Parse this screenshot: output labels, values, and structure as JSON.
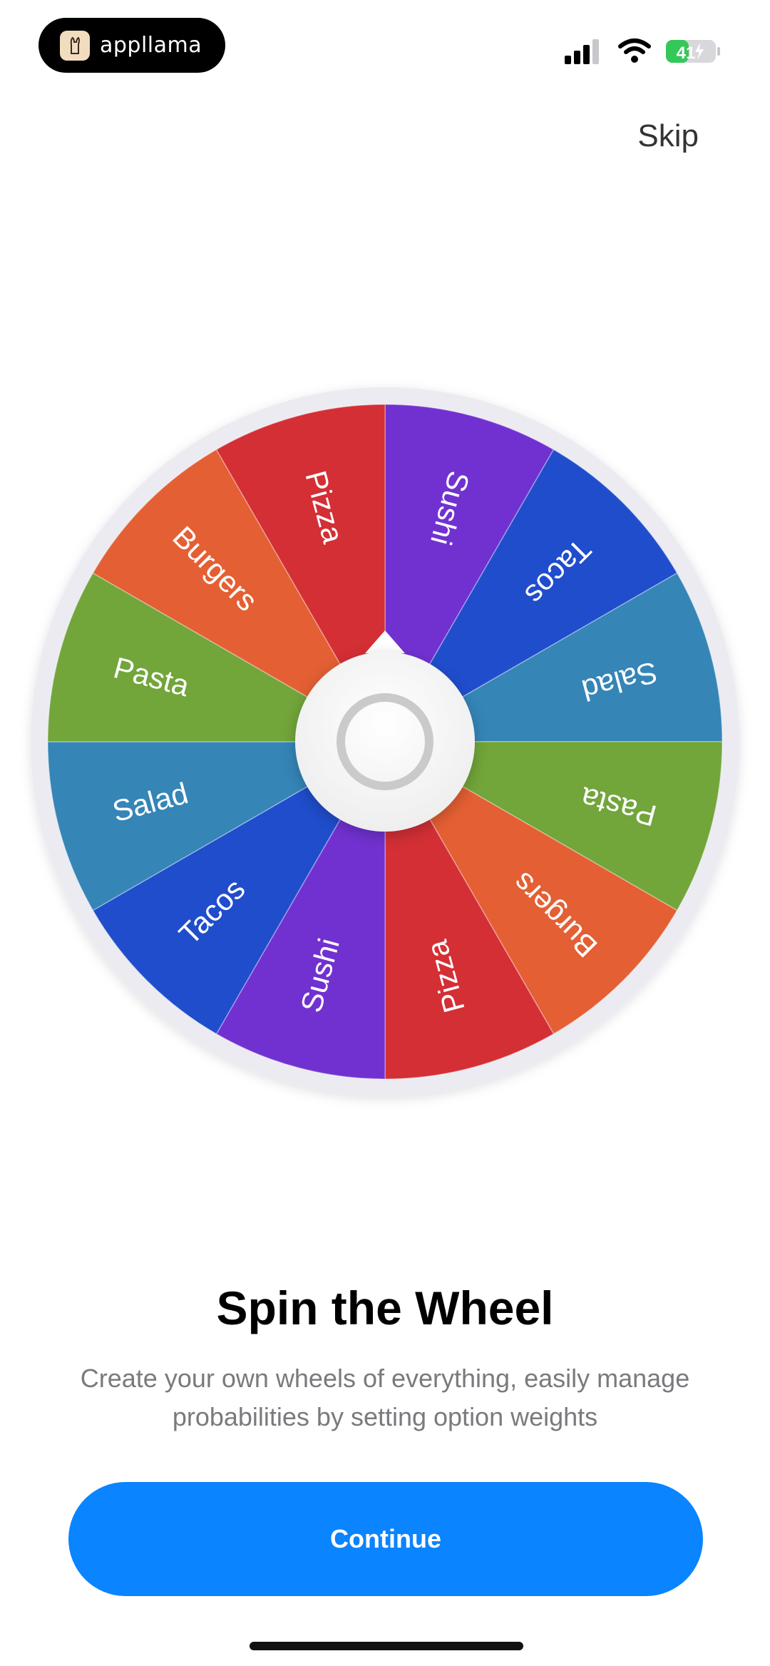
{
  "status": {
    "brand": "appllama",
    "battery": "41"
  },
  "header": {
    "skip_label": "Skip"
  },
  "wheel": {
    "segments": [
      {
        "label": "Sushi",
        "color": "#7131d0"
      },
      {
        "label": "Tacos",
        "color": "#1f4dcc"
      },
      {
        "label": "Salad",
        "color": "#3585b7"
      },
      {
        "label": "Pasta",
        "color": "#72a53a"
      },
      {
        "label": "Burgers",
        "color": "#e45f33"
      },
      {
        "label": "Pizza",
        "color": "#d32f35"
      },
      {
        "label": "Sushi",
        "color": "#7131d0"
      },
      {
        "label": "Tacos",
        "color": "#1f4dcc"
      },
      {
        "label": "Salad",
        "color": "#3585b7"
      },
      {
        "label": "Pasta",
        "color": "#72a53a"
      },
      {
        "label": "Burgers",
        "color": "#e45f33"
      },
      {
        "label": "Pizza",
        "color": "#d32f35"
      }
    ]
  },
  "onboarding": {
    "title": "Spin the Wheel",
    "subtitle_line1": "Create your own wheels of everything, easily manage",
    "subtitle_line2": "probabilities by setting option weights"
  },
  "cta": {
    "label": "Continue",
    "color": "#0a84ff"
  }
}
